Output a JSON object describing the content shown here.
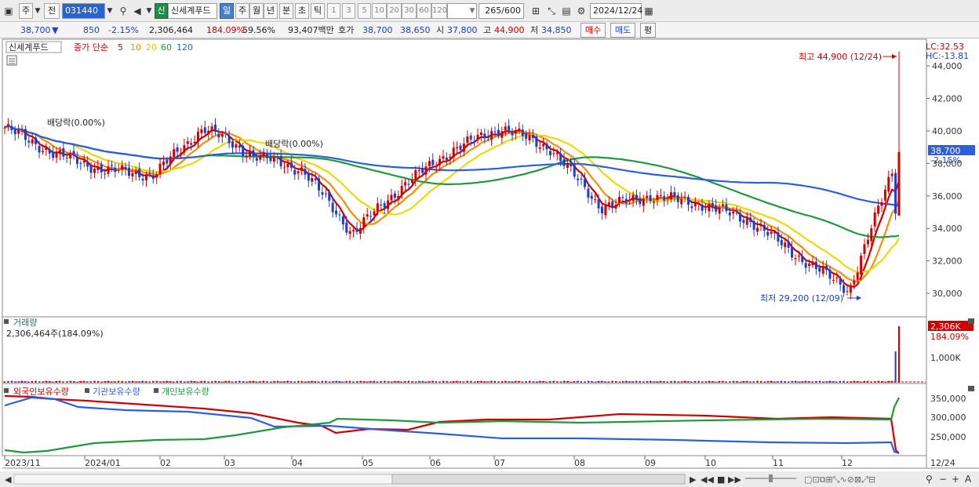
{
  "toolbar": {
    "market_type": "주",
    "prev_label": "전",
    "stock_code": "031440",
    "stock_badge": "신",
    "stock_name": "신세계푸드",
    "periods": [
      "일",
      "주",
      "월",
      "년",
      "분",
      "초",
      "틱"
    ],
    "selected_period": "일",
    "intervals": [
      "1",
      "3",
      "5",
      "10",
      "20",
      "30",
      "60",
      "120"
    ],
    "count_current": "265",
    "count_total": "/600",
    "date": "2024/12/24"
  },
  "quote": {
    "price": "38,700",
    "change_arrow": "▼",
    "change": "850",
    "change_pct": "-2.15%",
    "volume": "2,306,464",
    "volume_ratio": "184.09%",
    "turnover": "59.56%",
    "amount": "93,407백만",
    "bid_label": "호가",
    "ask_price": "38,700",
    "bid_price": "38,650",
    "open_label": "시",
    "open": "37,800",
    "high_label": "고",
    "high": "44,900",
    "low_label": "저",
    "low": "34,850",
    "buy_label": "매수",
    "sell_label": "매도",
    "eval_label": "평"
  },
  "price_panel": {
    "name_tag": "신세계푸드",
    "ma_legend_prefix": "종가 단순",
    "ma_periods": [
      "5",
      "10",
      "20",
      "60",
      "120"
    ],
    "ma_colors": [
      "#d40000",
      "#ff8c00",
      "#f0d800",
      "#1f9a3a",
      "#2c5fe0"
    ],
    "lc_label": "LC:32.53",
    "hc_label": "HC:-13.81",
    "dividend_label_1": "배당락(0.00%)",
    "dividend_label_2": "배당락(0.00%)",
    "high_annotation": "최고 44,900 (12/24)",
    "low_annotation": "최저 29,200 (12/09)",
    "y_ticks": [
      "44,000",
      "42,000",
      "40,000",
      "38,000",
      "36,000",
      "34,000",
      "32,000",
      "30,000"
    ],
    "current_price_box": "38,700",
    "current_change_box": "-2.15%"
  },
  "volume_panel": {
    "title": "거래량",
    "value_label": "2,306,464주(184.09%)",
    "tick": "1,000K",
    "current_box": "2,306K",
    "current_pct": "184.09%"
  },
  "holdings_panel": {
    "legend": [
      "외국인보유수량",
      "기관보유수량",
      "개인보유수량"
    ],
    "colors": [
      "#d40000",
      "#2c5fe0",
      "#1f9a3a"
    ],
    "ticks": [
      "350,000",
      "300,000",
      "250,000"
    ]
  },
  "x_axis": {
    "labels": [
      "2023/11",
      "2024/01",
      "02",
      "03",
      "04",
      "05",
      "06",
      "07",
      "08",
      "09",
      "10",
      "11",
      "12"
    ],
    "right_label": "12/24"
  },
  "colors": {
    "up": "#d40000",
    "down": "#1a3fd0",
    "accent": "#4a80c8"
  },
  "chart_data": {
    "type": "candlestick",
    "y_range": [
      28600,
      45600
    ],
    "y_unit": "KRW",
    "approx_close_path": [
      {
        "date": "2023/11",
        "close": 40200
      },
      {
        "date": "2023/12",
        "close": 38600
      },
      {
        "date": "2024/01",
        "close": 37600
      },
      {
        "date": "2024/01",
        "close": 37300
      },
      {
        "date": "2024/02",
        "close": 40200
      },
      {
        "date": "2024/03",
        "close": 38500
      },
      {
        "date": "2024/04",
        "close": 37600
      },
      {
        "date": "2024/04",
        "close": 33700
      },
      {
        "date": "2024/05",
        "close": 36600
      },
      {
        "date": "2024/06",
        "close": 38800
      },
      {
        "date": "2024/06",
        "close": 40200
      },
      {
        "date": "2024/07",
        "close": 38900
      },
      {
        "date": "2024/08",
        "close": 35300
      },
      {
        "date": "2024/09",
        "close": 36000
      },
      {
        "date": "2024/10",
        "close": 35500
      },
      {
        "date": "2024/11",
        "close": 34500
      },
      {
        "date": "2024/11",
        "close": 32200
      },
      {
        "date": "2024/12",
        "close": 30200
      },
      {
        "date": "2024/12/24",
        "close": 38700
      }
    ]
  }
}
